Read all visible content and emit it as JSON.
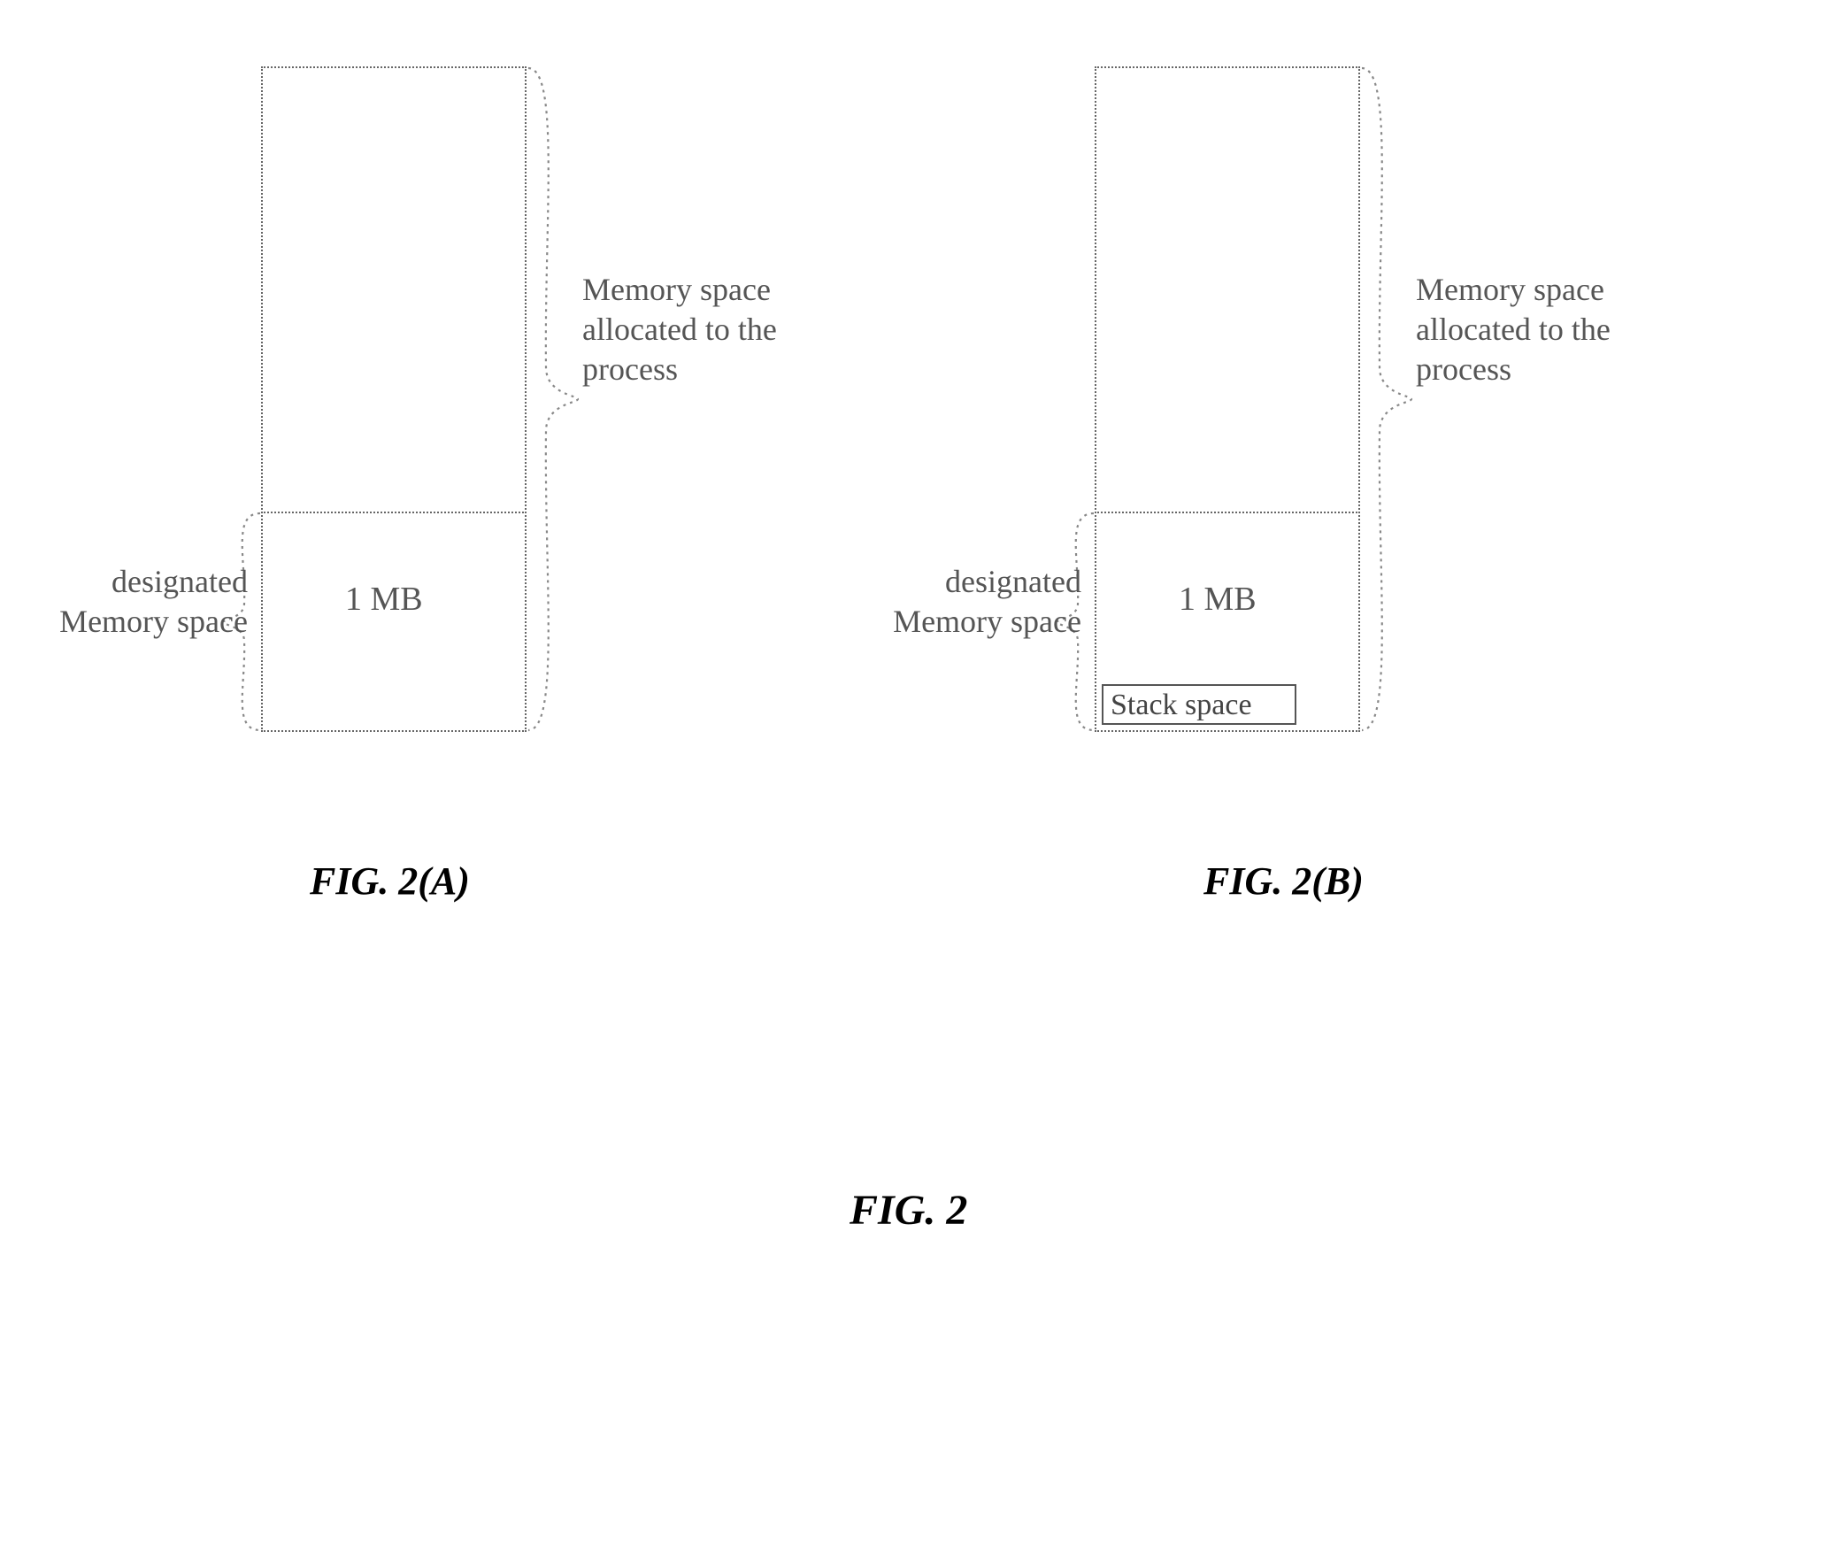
{
  "figure": {
    "main_caption": "FIG. 2",
    "a_caption": "FIG. 2(A)",
    "b_caption": "FIG. 2(B)"
  },
  "panel_a": {
    "right_label": "Memory space allocated to the process",
    "left_label": "designated Memory space",
    "size_label": "1 MB"
  },
  "panel_b": {
    "right_label": "Memory space allocated to the process",
    "left_label": "designated Memory space",
    "size_label": "1 MB",
    "stack_label": "Stack space"
  }
}
